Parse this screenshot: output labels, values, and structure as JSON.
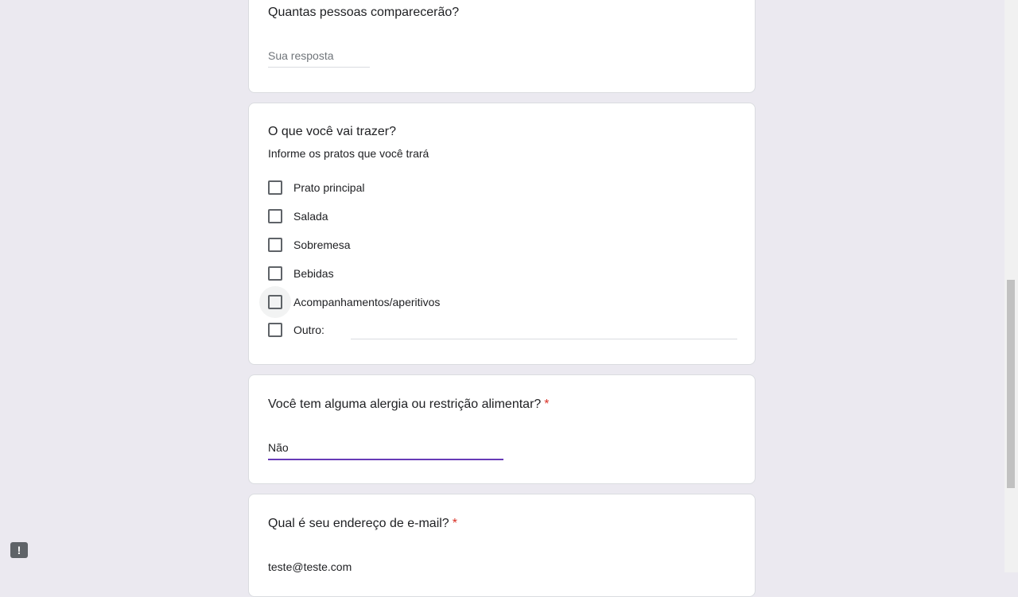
{
  "questions": {
    "attendees": {
      "title": "Quantas pessoas comparecerão?",
      "placeholder": "Sua resposta"
    },
    "bring": {
      "title": "O que você vai trazer?",
      "description": "Informe os pratos que você trará",
      "options": [
        "Prato principal",
        "Salada",
        "Sobremesa",
        "Bebidas",
        "Acompanhamentos/aperitivos"
      ],
      "other_label": "Outro:"
    },
    "allergy": {
      "title": "Você tem alguma alergia ou restrição alimentar?",
      "required_mark": "*",
      "answer": "Não"
    },
    "email": {
      "title": "Qual é seu endereço de e-mail?",
      "required_mark": "*",
      "answer": "teste@teste.com"
    }
  },
  "report_button": "!",
  "colors": {
    "background": "#ebe9f0",
    "accent": "#673ab7",
    "required": "#d93025"
  }
}
